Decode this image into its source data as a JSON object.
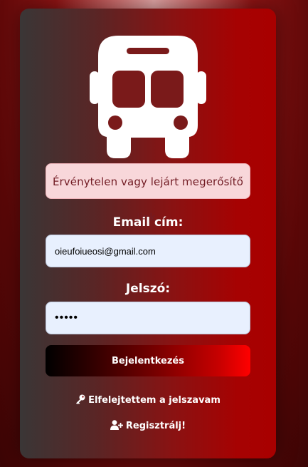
{
  "alert": {
    "message": "Érvénytelen vagy lejárt megerősítő link."
  },
  "form": {
    "email_label": "Email cím:",
    "email_value": "oieufoiueosi@gmail.com",
    "password_label": "Jelszó:",
    "password_value": "12345",
    "submit_label": "Bejelentkezés"
  },
  "links": {
    "forgot_password": "Elfelejtettem a jelszavam",
    "register": "Regisztrálj!"
  },
  "icons": {
    "logo": "bus-icon",
    "forgot": "key-icon",
    "register": "user-plus-icon"
  },
  "colors": {
    "alert_bg": "#f8d7da",
    "alert_text": "#721c24",
    "input_bg": "#e8f0fe",
    "accent_red": "#ff0000"
  }
}
